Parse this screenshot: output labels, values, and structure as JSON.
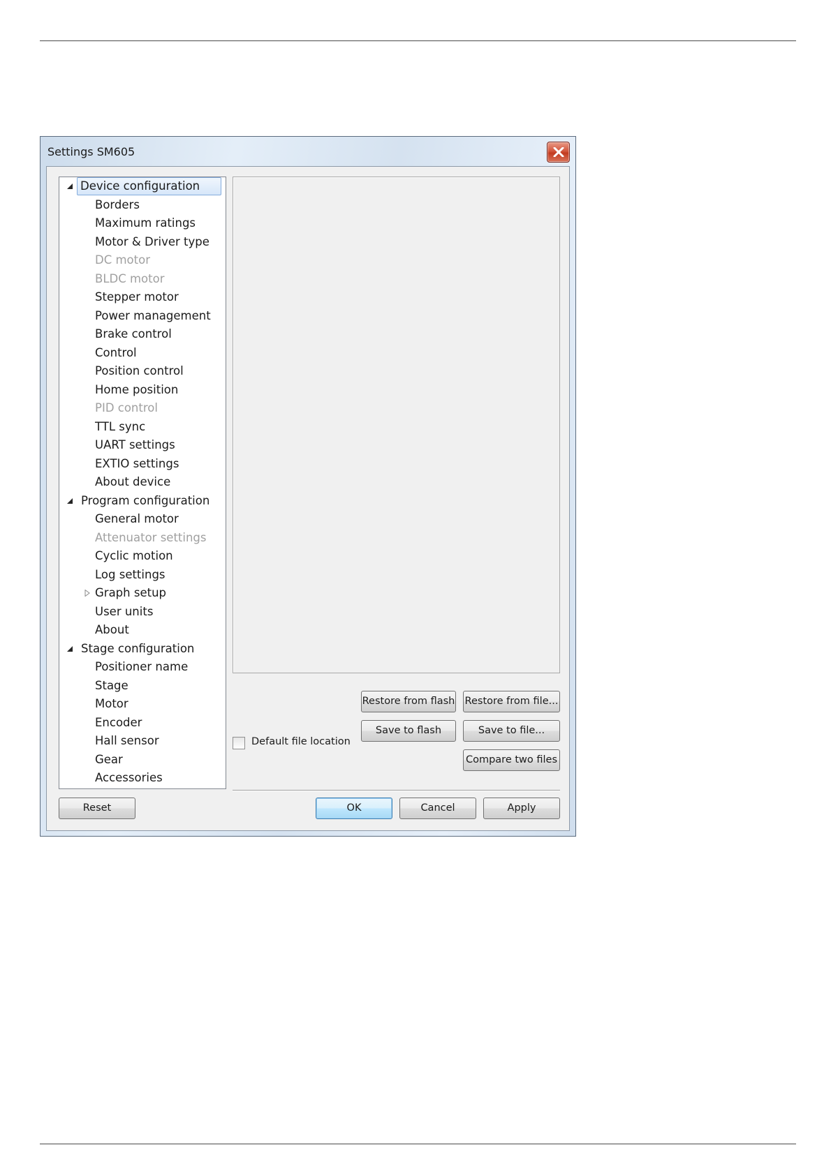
{
  "window": {
    "title": "Settings SM605",
    "close_icon": "close-x-icon"
  },
  "tree": {
    "items": [
      {
        "label": "Device configuration",
        "level": 0,
        "expander": "expanded",
        "selected": true,
        "enabled": true
      },
      {
        "label": "Borders",
        "level": 1,
        "enabled": true
      },
      {
        "label": "Maximum ratings",
        "level": 1,
        "enabled": true
      },
      {
        "label": "Motor & Driver type",
        "level": 1,
        "enabled": true
      },
      {
        "label": "DC motor",
        "level": 1,
        "enabled": false
      },
      {
        "label": "BLDC motor",
        "level": 1,
        "enabled": false
      },
      {
        "label": "Stepper motor",
        "level": 1,
        "enabled": true
      },
      {
        "label": "Power management",
        "level": 1,
        "enabled": true
      },
      {
        "label": "Brake control",
        "level": 1,
        "enabled": true
      },
      {
        "label": "Control",
        "level": 1,
        "enabled": true
      },
      {
        "label": "Position control",
        "level": 1,
        "enabled": true
      },
      {
        "label": "Home position",
        "level": 1,
        "enabled": true
      },
      {
        "label": "PID control",
        "level": 1,
        "enabled": false
      },
      {
        "label": "TTL sync",
        "level": 1,
        "enabled": true
      },
      {
        "label": "UART settings",
        "level": 1,
        "enabled": true
      },
      {
        "label": "EXTIO settings",
        "level": 1,
        "enabled": true
      },
      {
        "label": "About device",
        "level": 1,
        "enabled": true
      },
      {
        "label": "Program configuration",
        "level": 0,
        "expander": "expanded",
        "enabled": true
      },
      {
        "label": "General motor",
        "level": 1,
        "enabled": true
      },
      {
        "label": "Attenuator settings",
        "level": 1,
        "enabled": false
      },
      {
        "label": "Cyclic motion",
        "level": 1,
        "enabled": true
      },
      {
        "label": "Log settings",
        "level": 1,
        "enabled": true
      },
      {
        "label": "Graph setup",
        "level": 1,
        "expander": "collapsed",
        "enabled": true
      },
      {
        "label": "User units",
        "level": 1,
        "enabled": true
      },
      {
        "label": "About",
        "level": 1,
        "enabled": true
      },
      {
        "label": "Stage configuration",
        "level": 0,
        "expander": "expanded",
        "enabled": true
      },
      {
        "label": "Positioner name",
        "level": 1,
        "enabled": true
      },
      {
        "label": "Stage",
        "level": 1,
        "enabled": true
      },
      {
        "label": "Motor",
        "level": 1,
        "enabled": true
      },
      {
        "label": "Encoder",
        "level": 1,
        "enabled": true
      },
      {
        "label": "Hall sensor",
        "level": 1,
        "enabled": true
      },
      {
        "label": "Gear",
        "level": 1,
        "enabled": true
      },
      {
        "label": "Accessories",
        "level": 1,
        "enabled": true
      }
    ]
  },
  "buttons": {
    "restore_from_flash": "Restore from flash",
    "restore_from_file": "Restore from file...",
    "save_to_flash": "Save to flash",
    "save_to_file": "Save to file...",
    "compare_two_files": "Compare two files",
    "reset": "Reset",
    "ok": "OK",
    "cancel": "Cancel",
    "apply": "Apply"
  },
  "checkbox": {
    "label": "Default file location",
    "checked": false
  }
}
